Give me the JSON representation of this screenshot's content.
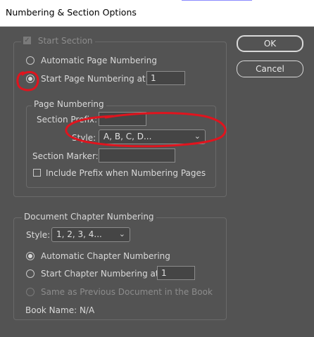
{
  "window": {
    "title": "Numbering & Section Options"
  },
  "buttons": {
    "ok": "OK",
    "cancel": "Cancel"
  },
  "start_section": {
    "label": "Start Section",
    "checked": true,
    "disabled": true
  },
  "page_numbering_mode": {
    "automatic_label": "Automatic Page Numbering",
    "start_at_label": "Start Page Numbering at:",
    "start_at_value": "1",
    "selected": "start_at"
  },
  "page_numbering": {
    "group_label": "Page Numbering",
    "section_prefix_label": "Section Prefix:",
    "section_prefix_value": "",
    "style_label": "Style:",
    "style_value": "A, B, C, D...",
    "section_marker_label": "Section Marker:",
    "section_marker_value": "",
    "include_prefix_label": "Include Prefix when Numbering Pages",
    "include_prefix_checked": false
  },
  "chapter_numbering": {
    "group_label": "Document Chapter Numbering",
    "style_label": "Style:",
    "style_value": "1, 2, 3, 4...",
    "automatic_label": "Automatic Chapter Numbering",
    "start_at_label": "Start Chapter Numbering at:",
    "start_at_value": "1",
    "same_as_previous_label": "Same as Previous Document in the Book",
    "book_name_label": "Book Name: N/A",
    "selected": "automatic"
  },
  "colors": {
    "background": "#535353",
    "annotation": "#e0141e"
  },
  "icons": {
    "dropdown": "chevron-down-icon"
  }
}
